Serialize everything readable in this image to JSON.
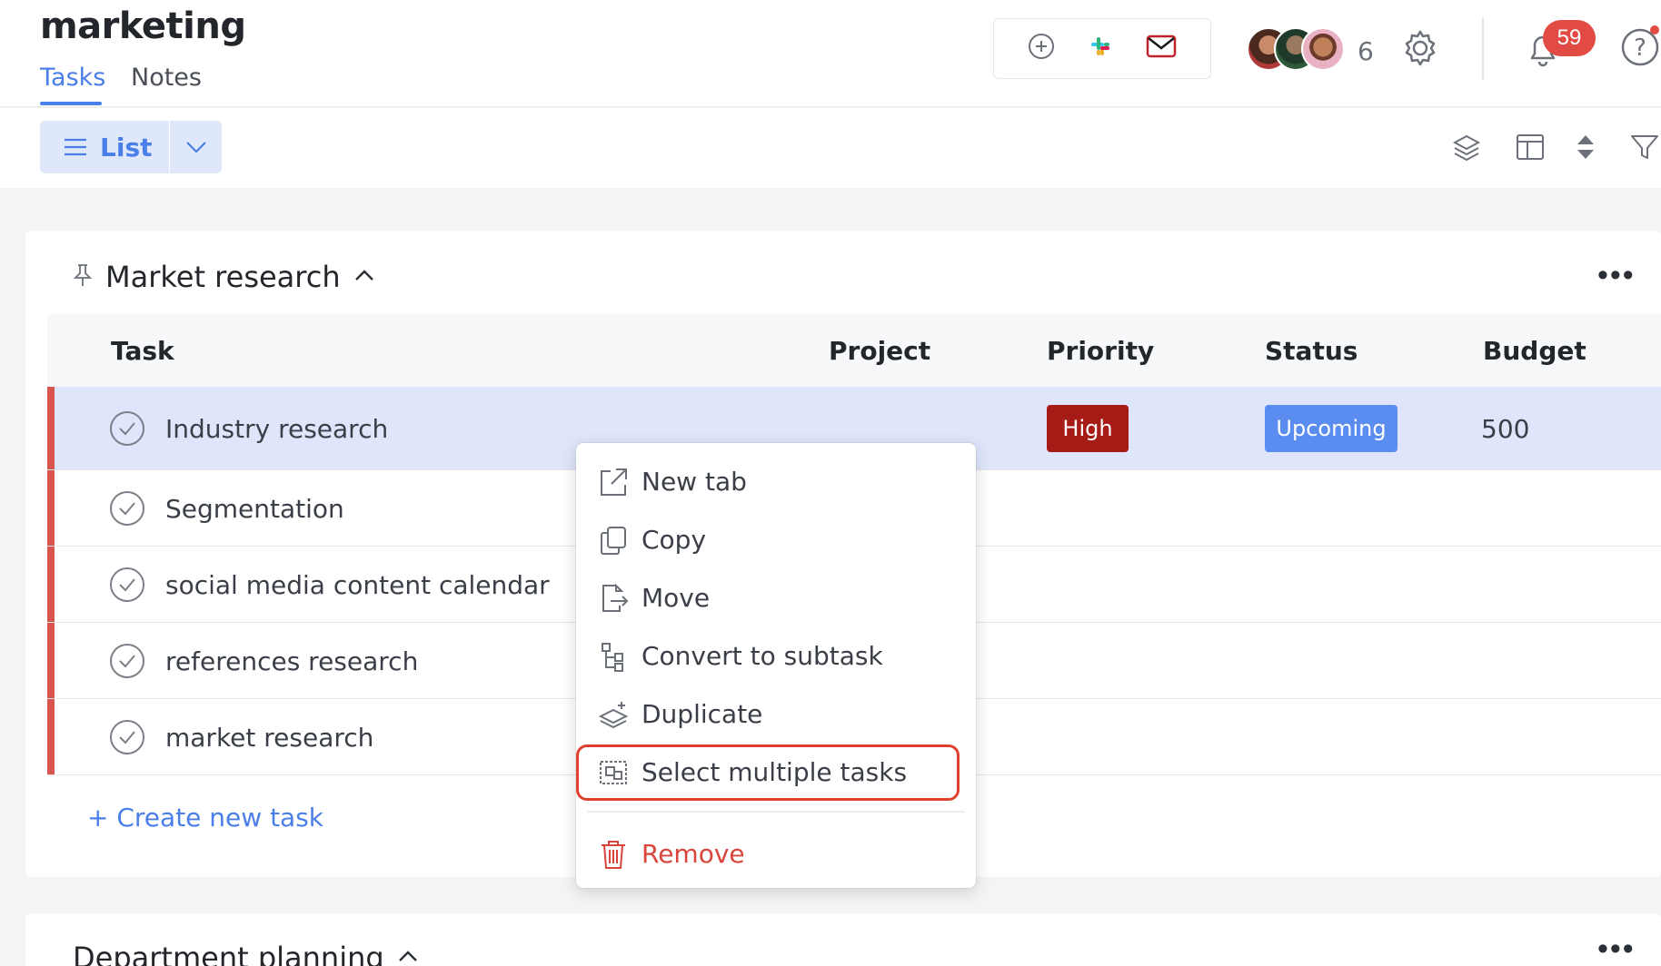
{
  "header": {
    "title": "marketing",
    "tabs": [
      {
        "label": "Tasks",
        "active": true
      },
      {
        "label": "Notes",
        "active": false
      }
    ],
    "member_count": "6",
    "notification_count": "59",
    "accent_color": "#4a7ee8"
  },
  "toolbar": {
    "view_label": "List",
    "icons": [
      "layers-icon",
      "columns-icon",
      "sort-icon",
      "filter-icon"
    ]
  },
  "groups": [
    {
      "title": "Market research",
      "columns": [
        "Task",
        "Project",
        "Priority",
        "Status",
        "Budget"
      ],
      "rows": [
        {
          "task": "Industry research",
          "project": "",
          "priority": "High",
          "status": "Upcoming",
          "budget": "500",
          "selected": true
        },
        {
          "task": "Segmentation",
          "project": "",
          "priority": "",
          "status": "",
          "budget": ""
        },
        {
          "task": "social media content calendar",
          "project": "",
          "priority": "",
          "status": "",
          "budget": ""
        },
        {
          "task": "references research",
          "project": "",
          "priority": "",
          "status": "",
          "budget": ""
        },
        {
          "task": "market research",
          "project": "",
          "priority": "",
          "status": "",
          "budget": ""
        }
      ],
      "create_label": "+ Create new task"
    },
    {
      "title": "Department planning"
    }
  ],
  "context_menu": {
    "items": [
      {
        "label": "New tab",
        "icon": "external-link-icon"
      },
      {
        "label": "Copy",
        "icon": "copy-icon"
      },
      {
        "label": "Move",
        "icon": "move-icon"
      },
      {
        "label": "Convert to subtask",
        "icon": "subtask-icon"
      },
      {
        "label": "Duplicate",
        "icon": "duplicate-icon"
      },
      {
        "label": "Select multiple tasks",
        "icon": "select-multiple-icon",
        "highlighted": true
      },
      {
        "label": "Remove",
        "icon": "trash-icon",
        "danger": true
      }
    ]
  },
  "colors": {
    "priority_high": "#a61b16",
    "status_upcoming": "#5b8df0",
    "row_stripe": "#d9534f",
    "danger": "#d9453c",
    "highlight_outline": "#e0412f"
  }
}
